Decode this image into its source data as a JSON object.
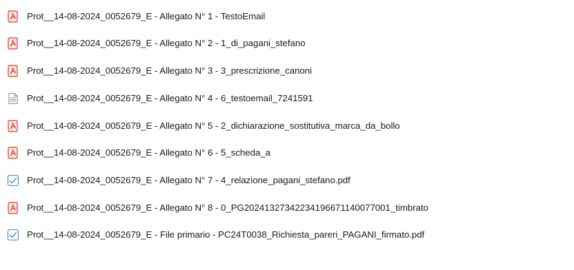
{
  "files": [
    {
      "name": "Prot__14-08-2024_0052679_E - Allegato N° 1 - TestoEmail",
      "icon": "pdf-icon"
    },
    {
      "name": "Prot__14-08-2024_0052679_E - Allegato N° 2 - 1_di_pagani_stefano",
      "icon": "pdf-icon"
    },
    {
      "name": "Prot__14-08-2024_0052679_E - Allegato N° 3 - 3_prescrizione_canoni",
      "icon": "pdf-icon"
    },
    {
      "name": "Prot__14-08-2024_0052679_E - Allegato N° 4 - 6_testoemail_7241591",
      "icon": "text-document-icon"
    },
    {
      "name": "Prot__14-08-2024_0052679_E - Allegato N° 5 - 2_dichiarazione_sostitutiva_marca_da_bollo",
      "icon": "pdf-icon"
    },
    {
      "name": "Prot__14-08-2024_0052679_E - Allegato N° 6 - 5_scheda_a",
      "icon": "pdf-icon"
    },
    {
      "name": "Prot__14-08-2024_0052679_E - Allegato N° 7 - 4_relazione_pagani_stefano.pdf",
      "icon": "checked-document-icon"
    },
    {
      "name": "Prot__14-08-2024_0052679_E - Allegato N° 8 - 0_PG20241327342234196671140077001_timbrato",
      "icon": "pdf-icon"
    },
    {
      "name": "Prot__14-08-2024_0052679_E - File primario - PC24T0038_Richiesta_pareri_PAGANI_firmato.pdf",
      "icon": "checked-document-icon"
    }
  ],
  "colors": {
    "pdf_red": "#d83b2b",
    "pdf_bg": "#fde7e4",
    "text_doc_gray": "#8a8a8a",
    "checked_blue": "#3a7bd5",
    "text": "#1a1a1a"
  }
}
